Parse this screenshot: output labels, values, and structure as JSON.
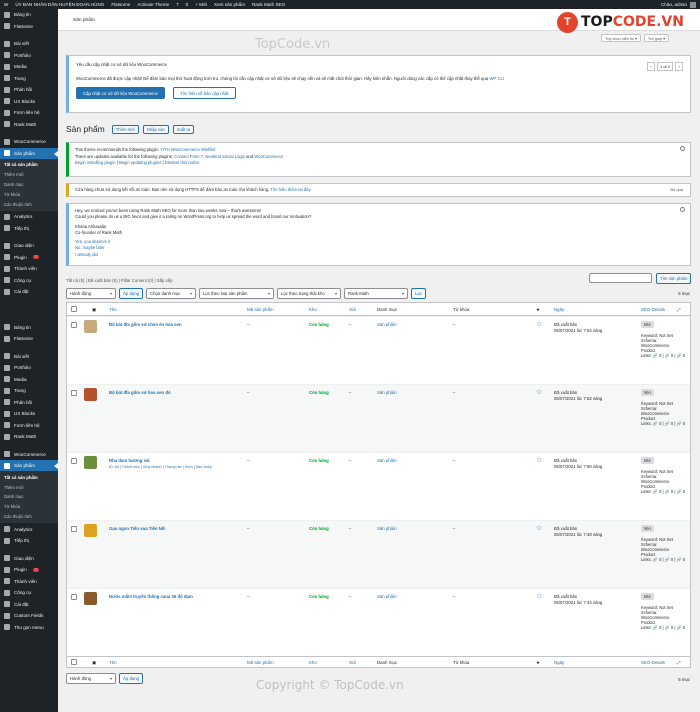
{
  "adminbar": {
    "items": [
      "W",
      "ỦY BAN NHÂN DÂN HUYỆN ĐOAN HÙNG",
      "Flatsome",
      "Activate Theme",
      "7",
      "0",
      "+ Mới",
      "Xem sản phẩm",
      "Rank Math SEO"
    ],
    "greeting": "Chào, admin"
  },
  "sidebar": {
    "top": [
      {
        "label": "Bảng tin"
      },
      {
        "label": "Flatsome"
      },
      {
        "sep": true
      },
      {
        "label": "Bài viết"
      },
      {
        "label": "Portfolio"
      },
      {
        "label": "Media"
      },
      {
        "label": "Trang"
      },
      {
        "label": "Phản hồi"
      },
      {
        "label": "UX Blocks"
      },
      {
        "label": "Form liên hệ"
      },
      {
        "label": "Rank Math"
      },
      {
        "sep": true
      },
      {
        "label": "WooCommerce"
      },
      {
        "label": "Sản phẩm",
        "current": true
      }
    ],
    "sub": [
      "Tất cả sản phẩm",
      "Thêm mới",
      "Danh mục",
      "Từ khóa",
      "Các thuộc tính"
    ],
    "bottom": [
      {
        "label": "Analytics"
      },
      {
        "label": "Tiếp thị"
      },
      {
        "sep": true
      },
      {
        "label": "Giao diện"
      },
      {
        "label": "Plugin",
        "badge": "7"
      },
      {
        "label": "Thành viên"
      },
      {
        "label": "Công cụ"
      },
      {
        "label": "Cài đặt"
      }
    ],
    "top2": [
      {
        "label": "Bảng tin"
      },
      {
        "label": "Flatsome"
      },
      {
        "sep": true
      },
      {
        "label": "Bài viết"
      },
      {
        "label": "Portfolio"
      },
      {
        "label": "Media"
      },
      {
        "label": "Trang"
      },
      {
        "label": "Phản hồi"
      },
      {
        "label": "UX Blocks"
      },
      {
        "label": "Form liên hệ"
      },
      {
        "label": "Rank Math"
      },
      {
        "sep": true
      },
      {
        "label": "WooCommerce"
      },
      {
        "label": "Sản phẩm",
        "current": true
      }
    ],
    "sub2": [
      "Tất cả sản phẩm",
      "Thêm mới",
      "Danh mục",
      "Từ khóa",
      "Các thuộc tính"
    ],
    "bottom2": [
      {
        "label": "Analytics"
      },
      {
        "label": "Tiếp thị"
      },
      {
        "sep": true
      },
      {
        "label": "Giao diện"
      },
      {
        "label": "Plugin",
        "badge": "7"
      },
      {
        "label": "Thành viên"
      },
      {
        "label": "Công cụ"
      },
      {
        "label": "Cài đặt"
      },
      {
        "label": "Custom Fields"
      },
      {
        "label": "Thu gọn menu"
      }
    ]
  },
  "header": {
    "title": "Sản phẩm",
    "screen_options": "Tùy chọn hiển thị ▾",
    "help": "Trợ giúp ▾"
  },
  "logo": {
    "mark": "T",
    "word_a": "TOP",
    "word_b": "CODE.VN"
  },
  "watermark": "TopCode.vn",
  "copyright": "Copyright © TopCode.vn",
  "wc_notice": {
    "line1": "Yêu cầu cập nhật cơ sở dữ liệu WooCommerce",
    "line2": "WooCommerce đã được cập nhật! Để đảm bảo mọi thứ hoạt động trơn tru, chúng tôi cần cập nhật cơ sở dữ liệu sẽ chạy nền và sẽ mất chút thời gian. Hãy kiên nhẫn. Người dùng các cấp có thể cập nhật thay thế qua ",
    "link": "WP CLI",
    "btn_primary": "Cập nhật cơ sở dữ liệu WooCommerce",
    "btn_secondary": "Tìm hiểu về bản cập nhật",
    "pager": {
      "prev": "‹",
      "current": "1 of 2",
      "next": "›"
    }
  },
  "page": {
    "heading": "Sản phẩm",
    "add_new": "Thêm mới",
    "import": "Nhập vào",
    "export": "Xuất ra"
  },
  "plugin_notice": {
    "l1a": "This theme recommends the following plugin: ",
    "l1b": "YITH WooCommerce Wishlist",
    "l2a": "There are updates available for the following plugins: ",
    "l2b": "Contact Form 7",
    "l2c": ", ",
    "l2d": "Nextend Social Login",
    "l2e": " and ",
    "l2f": "WooCommerce",
    "l3a": "Begin installing plugin",
    "l3b": "Begin updating plugins",
    "l3c": "Dismiss this notice"
  },
  "https_notice": {
    "text": "Cửa hàng chưa sử dụng kết nối an toàn. Bạn nên sử dụng HTTPS để đảm bảo an toàn cho khách hàng. ",
    "link": "Tìm hiểu thêm tại đây.",
    "dismiss": "Bỏ qua"
  },
  "rm_notice": {
    "l1": "Hey, we noticed you've been using Rank Math SEO for more than two weeks now – that's awesome!",
    "l2": "Could you please do us a BIG favor and give it a rating on WordPress.org to help us spread the word and boost our motivation?",
    "l3": "Khana Ahluwalia",
    "l4": "Co-founder of Rank Math",
    "a1": "Yes, you deserve it",
    "a2": "No, maybe later",
    "a3": "I already did"
  },
  "filters": {
    "subsubsub": "Tất cả (5) | Đã xuất bản (5) | Pillar Content (0) | Sắp xếp",
    "bulk": "Hành động",
    "apply": "Áp dụng",
    "cat": "Chọn danh mục",
    "type": "Lọc theo loại sản phẩm",
    "stock": "Lọc theo trạng thái kho",
    "rank": "Rank Math",
    "filter": "Lọc",
    "search_btn": "Tìm sản phẩm",
    "count": "5 mục"
  },
  "table": {
    "cols": {
      "image": "▣",
      "name": "Tên",
      "sku": "Mã sản phẩm",
      "stock": "Kho",
      "price": "Giá",
      "cats": "Danh mục",
      "tags": "Từ khóa",
      "featured": "★",
      "date": "Ngày",
      "seo": "SEO Details"
    },
    "rows": [
      {
        "name": "Bộ bát đĩa gốm sứ chim én hoa sen",
        "sku": "–",
        "stock": "Còn hàng",
        "price": "–",
        "cat": "Sản phẩm",
        "tags": "–",
        "date1": "Đã xuất bản",
        "date2": "05/07/2021 lúc 7:54 sáng",
        "actions": "",
        "thumb": "#c9a87c"
      },
      {
        "name": "Bộ bát đĩa gốm sứ hoa sen đỏ",
        "sku": "–",
        "stock": "Còn hàng",
        "price": "–",
        "cat": "Sản phẩm",
        "tags": "–",
        "date1": "Đã xuất bản",
        "date2": "05/07/2021 lúc 7:52 sáng",
        "actions": "",
        "thumb": "#b3522e"
      },
      {
        "name": "Rha dam hương sải",
        "sku": "–",
        "stock": "Còn hàng",
        "price": "–",
        "cat": "Sản phẩm",
        "tags": "–",
        "date1": "Đã xuất bản",
        "date2": "05/07/2021 lúc 7:50 sáng",
        "actions": "ID: 84 | Chỉnh sửa | Sửa nhanh | Thùng rác | Xem | Sao chép",
        "thumb": "#6b8f3a"
      },
      {
        "name": "Gạo ngon Tiến vua Tiên Nữ",
        "sku": "–",
        "stock": "Còn hàng",
        "price": "–",
        "cat": "Sản phẩm",
        "tags": "–",
        "date1": "Đã xuất bản",
        "date2": "05/07/2021 lúc 7:48 sáng",
        "actions": "",
        "thumb": "#e0a020"
      },
      {
        "name": "Nước mắm truyền thống cana 35 độ đạm",
        "sku": "–",
        "stock": "Còn hàng",
        "price": "–",
        "cat": "Sản phẩm",
        "tags": "–",
        "date1": "Đã xuất bản",
        "date2": "05/07/2021 lúc 7:44 sáng",
        "actions": "",
        "thumb": "#8a5a2b"
      }
    ],
    "seo": {
      "na": "N/A",
      "kw": "Keyword: Not Set",
      "schema": "Schema:",
      "schema_val": "WooCommerce",
      "schema_val2": "Product",
      "links": "Links: 🔗 0 | 🔗 0 | 🔗 0"
    }
  }
}
